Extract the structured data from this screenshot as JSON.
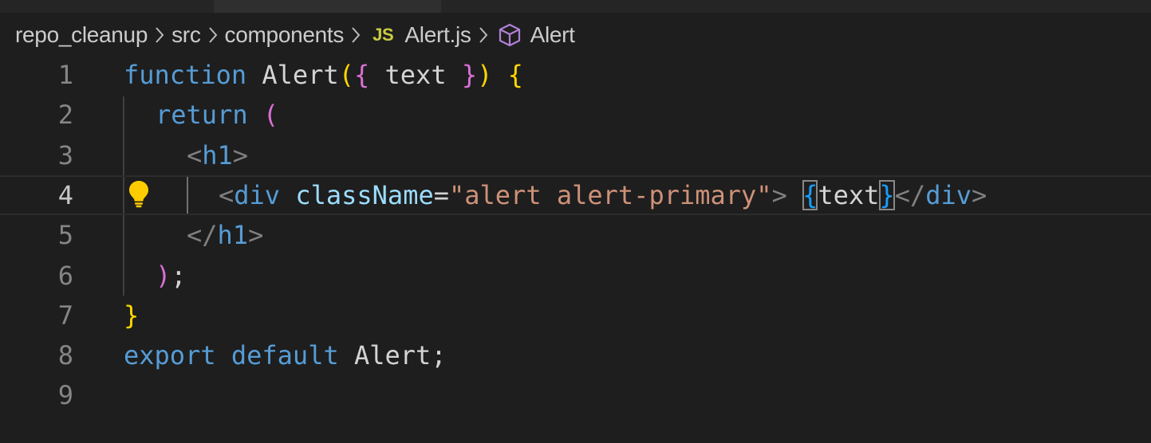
{
  "breadcrumb": {
    "items": [
      "repo_cleanup",
      "src",
      "components",
      "Alert.js",
      "Alert"
    ],
    "file_badge": "JS"
  },
  "icons": {
    "separator": "chevron-right-icon",
    "file": "javascript-file-icon",
    "symbol": "symbol-cube-icon",
    "code_action": "lightbulb-icon"
  },
  "colors": {
    "background": "#1e1e1e",
    "keyword": "#569cd6",
    "bracket_level1": "#ffd700",
    "bracket_level2": "#da70d6",
    "string": "#ce9178",
    "attribute": "#9cdcfe"
  },
  "editor": {
    "current_line": 4,
    "lines": [
      {
        "num": "1",
        "t": [
          "function",
          " ",
          "Alert",
          "(",
          "{",
          " text ",
          "}",
          ")",
          " ",
          "{"
        ]
      },
      {
        "num": "2",
        "t": [
          "return",
          " ",
          "("
        ]
      },
      {
        "num": "3",
        "t": [
          "<",
          "h1",
          ">"
        ]
      },
      {
        "num": "4",
        "t": [
          "<",
          "div",
          " ",
          "className",
          "=",
          "\"alert alert-primary\"",
          ">",
          " ",
          "{",
          "text",
          "}",
          "</",
          "div",
          ">"
        ]
      },
      {
        "num": "5",
        "t": [
          "</",
          "h1",
          ">"
        ]
      },
      {
        "num": "6",
        "t": [
          ")",
          ";"
        ]
      },
      {
        "num": "7",
        "t": [
          "}"
        ]
      },
      {
        "num": "8",
        "t": [
          "export",
          " ",
          "default",
          " Alert;"
        ]
      },
      {
        "num": "9",
        "t": []
      }
    ]
  }
}
